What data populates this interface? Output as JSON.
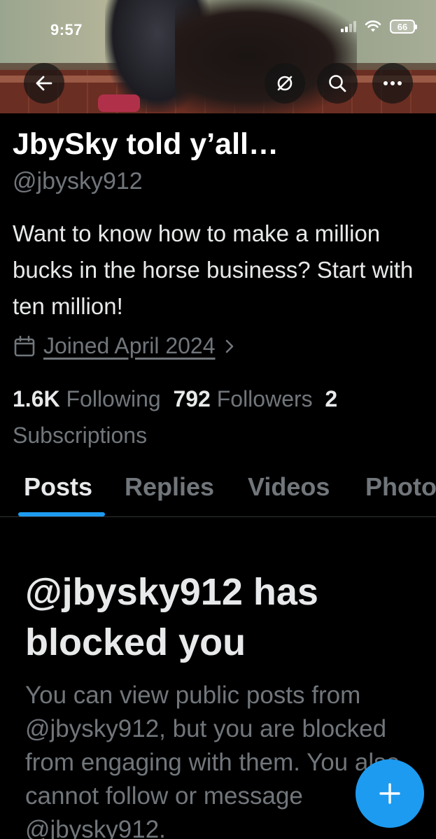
{
  "status_bar": {
    "time": "9:57",
    "battery": "66"
  },
  "banner": {
    "back_icon": "arrow-left-icon",
    "grok_icon": "slash-circle-icon",
    "search_icon": "search-icon",
    "more_icon": "more-horizontal-icon"
  },
  "profile": {
    "display_name": "JbySky told y’all…",
    "handle": "@jbysky912",
    "bio": "Want to know how to make a million bucks in the horse business? Start with ten million!",
    "joined": "Joined April 2024",
    "following_count": "1.6K",
    "following_label": "Following",
    "followers_count": "792",
    "followers_label": "Followers",
    "subscriptions_count": "2",
    "subscriptions_label": "Subscriptions"
  },
  "tabs": [
    {
      "label": "Posts",
      "active": true
    },
    {
      "label": "Replies",
      "active": false
    },
    {
      "label": "Videos",
      "active": false
    },
    {
      "label": "Photos",
      "active": false
    }
  ],
  "blocked": {
    "title": "@jbysky912 has blocked you",
    "description": "You can view public posts from @jbysky912, but you are blocked from engaging with them. You also cannot follow or message @jbysky912."
  },
  "fab": {
    "icon": "plus-icon"
  },
  "colors": {
    "accent": "#1d9bf0",
    "background": "#000000",
    "secondary_text": "#71767b"
  }
}
